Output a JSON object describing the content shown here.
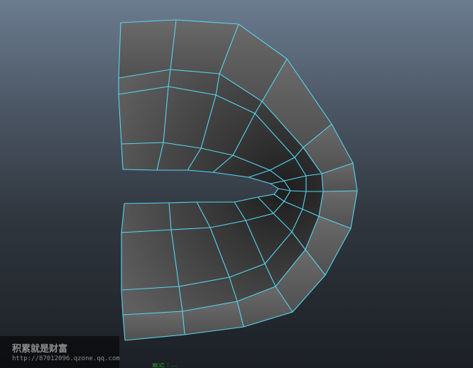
{
  "viewport": {
    "background_top": "#6b7c8f",
    "background_bottom": "#1c2025",
    "wire_color": "#56d6f0",
    "face_light": "#6a6a6a",
    "face_dark": "#1e1e1e"
  },
  "watermark": {
    "title": "积累就是财富",
    "url": "http://87012096.qzone.qq.com"
  },
  "status": {
    "snippet": "最近 : ..."
  }
}
